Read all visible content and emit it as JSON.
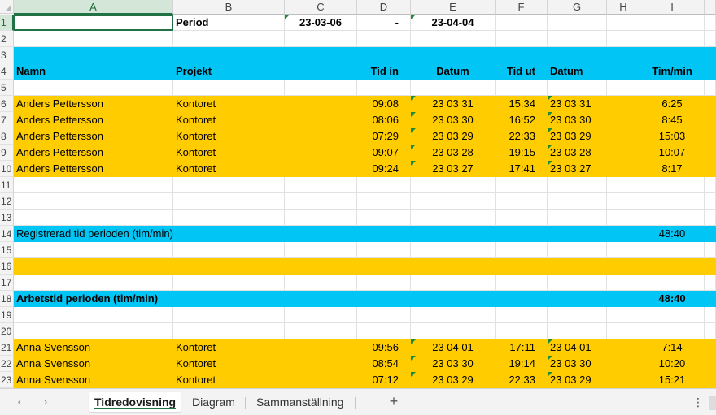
{
  "columns": [
    "A",
    "B",
    "C",
    "D",
    "E",
    "F",
    "G",
    "H",
    "I"
  ],
  "rows": [
    {
      "n": "1",
      "style": "white",
      "cells": {
        "B": "Period",
        "C": "23-03-06",
        "D": "-",
        "E": "23-04-04"
      }
    },
    {
      "n": "2",
      "style": "white",
      "cells": {}
    },
    {
      "n": "3",
      "style": "blue",
      "cells": {}
    },
    {
      "n": "4",
      "style": "blue2",
      "cells": {
        "A": "Namn",
        "B": "Projekt",
        "D": "Tid in",
        "E": "Datum",
        "F": "Tid ut",
        "G": "Datum",
        "I": "Tim/min"
      }
    },
    {
      "n": "5",
      "style": "white",
      "cells": {}
    },
    {
      "n": "6",
      "style": "yellow",
      "cells": {
        "A": "Anders Pettersson",
        "B": "Kontoret",
        "D": "09:08",
        "E": "23 03 31",
        "F": "15:34",
        "G": "23 03 31",
        "I": "6:25"
      }
    },
    {
      "n": "7",
      "style": "yellow",
      "cells": {
        "A": "Anders Pettersson",
        "B": "Kontoret",
        "D": "08:06",
        "E": "23 03 30",
        "F": "16:52",
        "G": "23 03 30",
        "I": "8:45"
      }
    },
    {
      "n": "8",
      "style": "yellow",
      "cells": {
        "A": "Anders Pettersson",
        "B": "Kontoret",
        "D": "07:29",
        "E": "23 03 29",
        "F": "22:33",
        "G": "23 03 29",
        "I": "15:03"
      }
    },
    {
      "n": "9",
      "style": "yellow",
      "cells": {
        "A": "Anders Pettersson",
        "B": "Kontoret",
        "D": "09:07",
        "E": "23 03 28",
        "F": "19:15",
        "G": "23 03 28",
        "I": "10:07"
      }
    },
    {
      "n": "10",
      "style": "yellow",
      "cells": {
        "A": "Anders Pettersson",
        "B": "Kontoret",
        "D": "09:24",
        "E": "23 03 27",
        "F": "17:41",
        "G": "23 03 27",
        "I": "8:17"
      }
    },
    {
      "n": "11",
      "style": "white",
      "cells": {}
    },
    {
      "n": "12",
      "style": "white",
      "cells": {}
    },
    {
      "n": "13",
      "style": "white",
      "cells": {}
    },
    {
      "n": "14",
      "style": "blue",
      "cells": {
        "A": "Registrerad tid perioden (tim/min)",
        "I": "48:40"
      }
    },
    {
      "n": "15",
      "style": "white",
      "cells": {}
    },
    {
      "n": "16",
      "style": "yellow",
      "cells": {}
    },
    {
      "n": "17",
      "style": "white",
      "cells": {}
    },
    {
      "n": "18",
      "style": "blue",
      "cells": {
        "A": "Arbetstid perioden (tim/min)",
        "I": "48:40"
      }
    },
    {
      "n": "19",
      "style": "white",
      "cells": {}
    },
    {
      "n": "20",
      "style": "white",
      "cells": {}
    },
    {
      "n": "21",
      "style": "yellow",
      "cells": {
        "A": "Anna Svensson",
        "B": "Kontoret",
        "D": "09:56",
        "E": "23 04 01",
        "F": "17:11",
        "G": "23 04 01",
        "I": "7:14"
      }
    },
    {
      "n": "22",
      "style": "yellow",
      "cells": {
        "A": "Anna Svensson",
        "B": "Kontoret",
        "D": "08:54",
        "E": "23 03 30",
        "F": "19:14",
        "G": "23 03 30",
        "I": "10:20"
      }
    },
    {
      "n": "23",
      "style": "yellow",
      "cells": {
        "A": "Anna Svensson",
        "B": "Kontoret",
        "D": "07:12",
        "E": "23 03 29",
        "F": "22:33",
        "G": "23 03 29",
        "I": "15:21"
      }
    },
    {
      "n": "",
      "style": "yellow",
      "cells": {}
    }
  ],
  "tabs": [
    {
      "label": "Tidredovisning",
      "active": true
    },
    {
      "label": "Diagram",
      "active": false
    },
    {
      "label": "Sammanställning",
      "active": false
    }
  ],
  "tabbar": {
    "prev": "‹",
    "next": "›",
    "add": "+",
    "more": "⋮"
  },
  "colors": {
    "header_blue": "#00c5f5",
    "row_yellow": "#ffcc00",
    "excel_green": "#217346"
  }
}
